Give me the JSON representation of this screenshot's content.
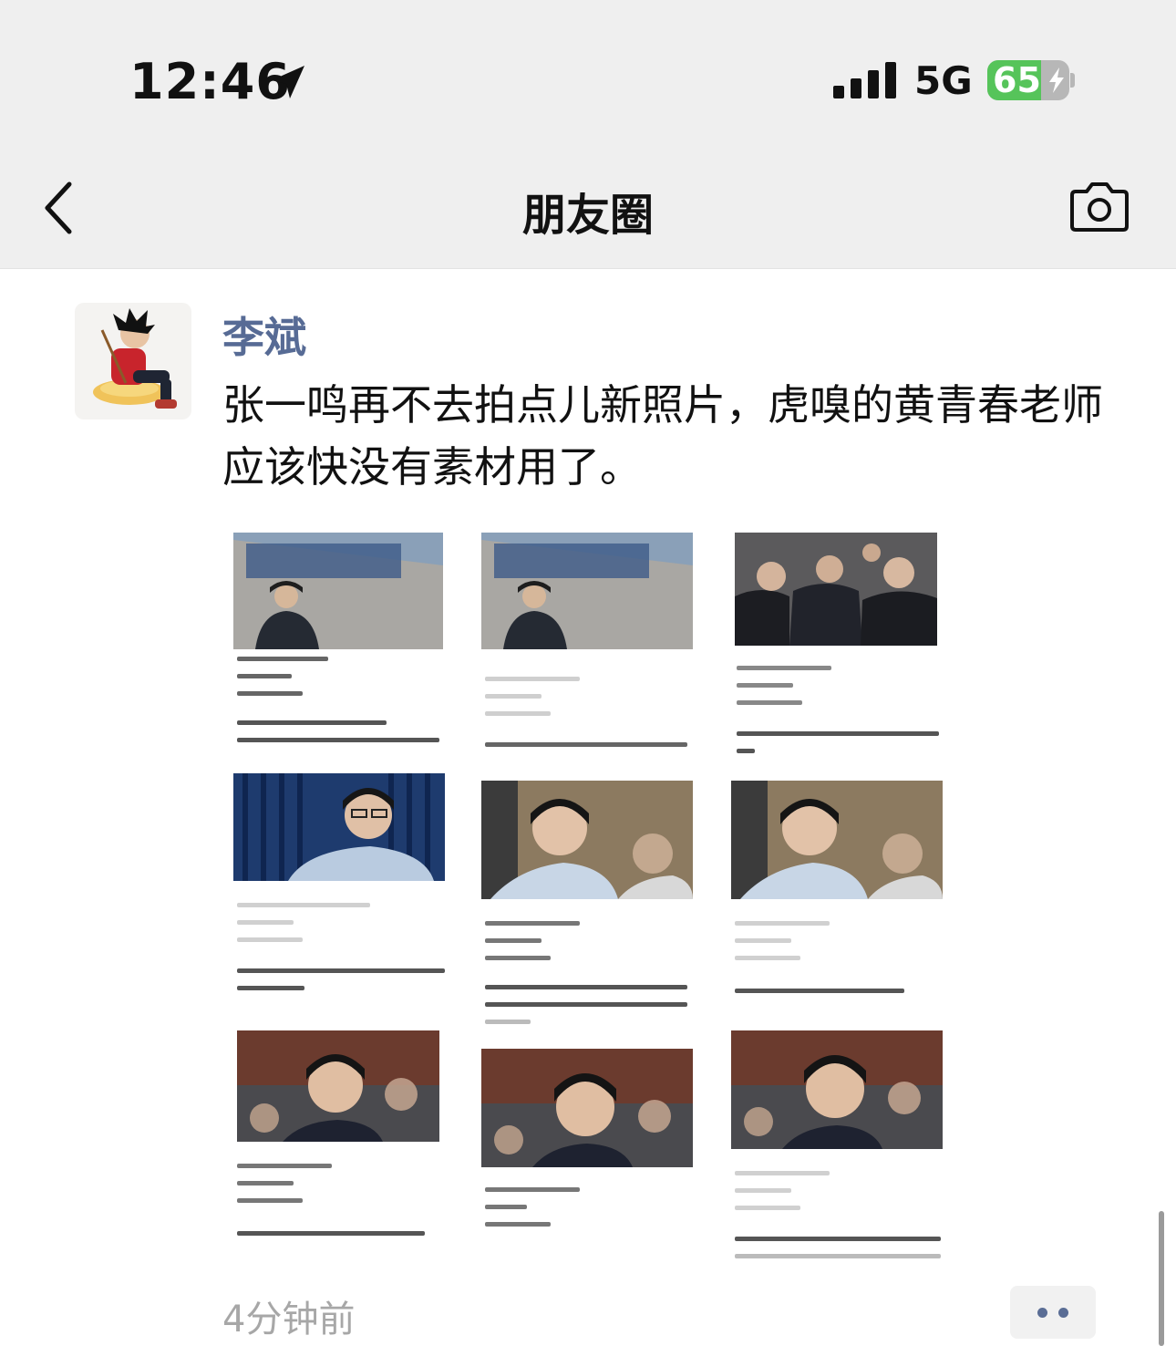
{
  "status_bar": {
    "time": "12:46",
    "network": "5G",
    "battery": "65",
    "battery_level": 0.65,
    "battery_color": "#56c45a"
  },
  "nav": {
    "title": "朋友圈",
    "back_icon": "chevron-left-icon",
    "camera_icon": "camera-icon"
  },
  "post": {
    "author": "李斌",
    "author_color": "#576b95",
    "text": "张一鸣再不去拍点儿新照片，虎嗅的黄青春老师应该快没有素材用了。",
    "timestamp": "4分钟前",
    "more_icon": "more-dots-icon"
  }
}
